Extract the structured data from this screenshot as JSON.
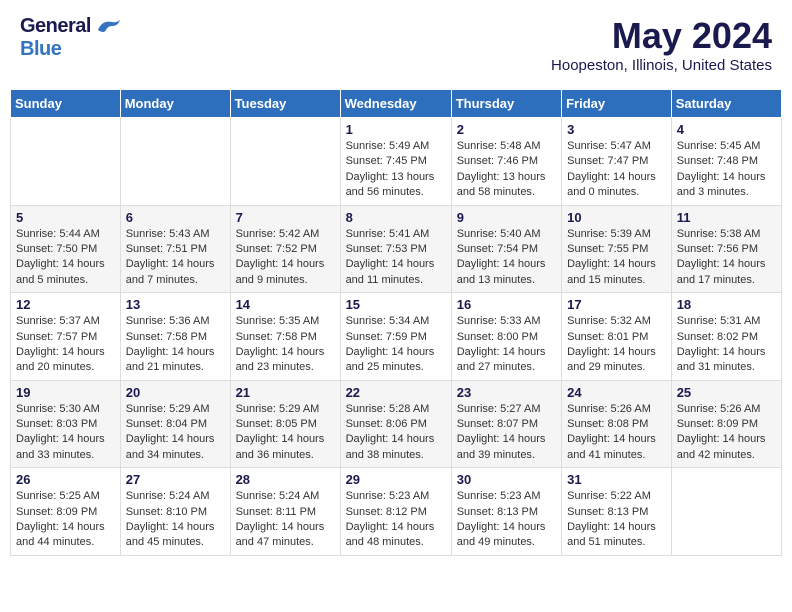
{
  "header": {
    "logo_general": "General",
    "logo_blue": "Blue",
    "title": "May 2024",
    "location": "Hoopeston, Illinois, United States"
  },
  "days_of_week": [
    "Sunday",
    "Monday",
    "Tuesday",
    "Wednesday",
    "Thursday",
    "Friday",
    "Saturday"
  ],
  "weeks": [
    [
      {
        "day": "",
        "sunrise": "",
        "sunset": "",
        "daylight": ""
      },
      {
        "day": "",
        "sunrise": "",
        "sunset": "",
        "daylight": ""
      },
      {
        "day": "",
        "sunrise": "",
        "sunset": "",
        "daylight": ""
      },
      {
        "day": "1",
        "sunrise": "Sunrise: 5:49 AM",
        "sunset": "Sunset: 7:45 PM",
        "daylight": "Daylight: 13 hours and 56 minutes."
      },
      {
        "day": "2",
        "sunrise": "Sunrise: 5:48 AM",
        "sunset": "Sunset: 7:46 PM",
        "daylight": "Daylight: 13 hours and 58 minutes."
      },
      {
        "day": "3",
        "sunrise": "Sunrise: 5:47 AM",
        "sunset": "Sunset: 7:47 PM",
        "daylight": "Daylight: 14 hours and 0 minutes."
      },
      {
        "day": "4",
        "sunrise": "Sunrise: 5:45 AM",
        "sunset": "Sunset: 7:48 PM",
        "daylight": "Daylight: 14 hours and 3 minutes."
      }
    ],
    [
      {
        "day": "5",
        "sunrise": "Sunrise: 5:44 AM",
        "sunset": "Sunset: 7:50 PM",
        "daylight": "Daylight: 14 hours and 5 minutes."
      },
      {
        "day": "6",
        "sunrise": "Sunrise: 5:43 AM",
        "sunset": "Sunset: 7:51 PM",
        "daylight": "Daylight: 14 hours and 7 minutes."
      },
      {
        "day": "7",
        "sunrise": "Sunrise: 5:42 AM",
        "sunset": "Sunset: 7:52 PM",
        "daylight": "Daylight: 14 hours and 9 minutes."
      },
      {
        "day": "8",
        "sunrise": "Sunrise: 5:41 AM",
        "sunset": "Sunset: 7:53 PM",
        "daylight": "Daylight: 14 hours and 11 minutes."
      },
      {
        "day": "9",
        "sunrise": "Sunrise: 5:40 AM",
        "sunset": "Sunset: 7:54 PM",
        "daylight": "Daylight: 14 hours and 13 minutes."
      },
      {
        "day": "10",
        "sunrise": "Sunrise: 5:39 AM",
        "sunset": "Sunset: 7:55 PM",
        "daylight": "Daylight: 14 hours and 15 minutes."
      },
      {
        "day": "11",
        "sunrise": "Sunrise: 5:38 AM",
        "sunset": "Sunset: 7:56 PM",
        "daylight": "Daylight: 14 hours and 17 minutes."
      }
    ],
    [
      {
        "day": "12",
        "sunrise": "Sunrise: 5:37 AM",
        "sunset": "Sunset: 7:57 PM",
        "daylight": "Daylight: 14 hours and 20 minutes."
      },
      {
        "day": "13",
        "sunrise": "Sunrise: 5:36 AM",
        "sunset": "Sunset: 7:58 PM",
        "daylight": "Daylight: 14 hours and 21 minutes."
      },
      {
        "day": "14",
        "sunrise": "Sunrise: 5:35 AM",
        "sunset": "Sunset: 7:58 PM",
        "daylight": "Daylight: 14 hours and 23 minutes."
      },
      {
        "day": "15",
        "sunrise": "Sunrise: 5:34 AM",
        "sunset": "Sunset: 7:59 PM",
        "daylight": "Daylight: 14 hours and 25 minutes."
      },
      {
        "day": "16",
        "sunrise": "Sunrise: 5:33 AM",
        "sunset": "Sunset: 8:00 PM",
        "daylight": "Daylight: 14 hours and 27 minutes."
      },
      {
        "day": "17",
        "sunrise": "Sunrise: 5:32 AM",
        "sunset": "Sunset: 8:01 PM",
        "daylight": "Daylight: 14 hours and 29 minutes."
      },
      {
        "day": "18",
        "sunrise": "Sunrise: 5:31 AM",
        "sunset": "Sunset: 8:02 PM",
        "daylight": "Daylight: 14 hours and 31 minutes."
      }
    ],
    [
      {
        "day": "19",
        "sunrise": "Sunrise: 5:30 AM",
        "sunset": "Sunset: 8:03 PM",
        "daylight": "Daylight: 14 hours and 33 minutes."
      },
      {
        "day": "20",
        "sunrise": "Sunrise: 5:29 AM",
        "sunset": "Sunset: 8:04 PM",
        "daylight": "Daylight: 14 hours and 34 minutes."
      },
      {
        "day": "21",
        "sunrise": "Sunrise: 5:29 AM",
        "sunset": "Sunset: 8:05 PM",
        "daylight": "Daylight: 14 hours and 36 minutes."
      },
      {
        "day": "22",
        "sunrise": "Sunrise: 5:28 AM",
        "sunset": "Sunset: 8:06 PM",
        "daylight": "Daylight: 14 hours and 38 minutes."
      },
      {
        "day": "23",
        "sunrise": "Sunrise: 5:27 AM",
        "sunset": "Sunset: 8:07 PM",
        "daylight": "Daylight: 14 hours and 39 minutes."
      },
      {
        "day": "24",
        "sunrise": "Sunrise: 5:26 AM",
        "sunset": "Sunset: 8:08 PM",
        "daylight": "Daylight: 14 hours and 41 minutes."
      },
      {
        "day": "25",
        "sunrise": "Sunrise: 5:26 AM",
        "sunset": "Sunset: 8:09 PM",
        "daylight": "Daylight: 14 hours and 42 minutes."
      }
    ],
    [
      {
        "day": "26",
        "sunrise": "Sunrise: 5:25 AM",
        "sunset": "Sunset: 8:09 PM",
        "daylight": "Daylight: 14 hours and 44 minutes."
      },
      {
        "day": "27",
        "sunrise": "Sunrise: 5:24 AM",
        "sunset": "Sunset: 8:10 PM",
        "daylight": "Daylight: 14 hours and 45 minutes."
      },
      {
        "day": "28",
        "sunrise": "Sunrise: 5:24 AM",
        "sunset": "Sunset: 8:11 PM",
        "daylight": "Daylight: 14 hours and 47 minutes."
      },
      {
        "day": "29",
        "sunrise": "Sunrise: 5:23 AM",
        "sunset": "Sunset: 8:12 PM",
        "daylight": "Daylight: 14 hours and 48 minutes."
      },
      {
        "day": "30",
        "sunrise": "Sunrise: 5:23 AM",
        "sunset": "Sunset: 8:13 PM",
        "daylight": "Daylight: 14 hours and 49 minutes."
      },
      {
        "day": "31",
        "sunrise": "Sunrise: 5:22 AM",
        "sunset": "Sunset: 8:13 PM",
        "daylight": "Daylight: 14 hours and 51 minutes."
      },
      {
        "day": "",
        "sunrise": "",
        "sunset": "",
        "daylight": ""
      }
    ]
  ]
}
